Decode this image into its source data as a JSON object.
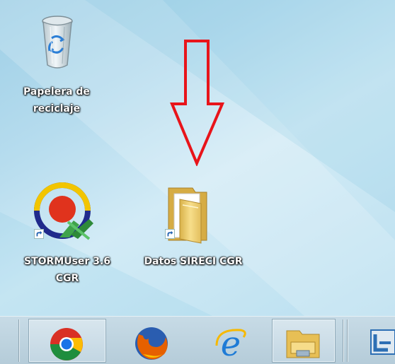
{
  "desktop": {
    "icons": [
      {
        "label_line1": "Papelera de",
        "label_line2": "reciclaje",
        "icon": "recycle-bin-icon",
        "shortcut": false
      },
      {
        "label_line1": "STORMUser 3.6",
        "label_line2": "CGR",
        "icon": "stormuser-app-icon",
        "shortcut": true
      },
      {
        "label_line1": "Datos SIRECI CGR",
        "label_line2": "",
        "icon": "folder-icon",
        "shortcut": true
      }
    ],
    "annotation": {
      "icon": "red-down-arrow-icon",
      "color": "#e8141a"
    }
  },
  "taskbar": {
    "pinned": [
      {
        "icon": "chrome-icon",
        "active": true
      },
      {
        "icon": "firefox-icon",
        "active": false
      },
      {
        "icon": "internet-explorer-icon",
        "active": false
      },
      {
        "icon": "file-explorer-icon",
        "active": true
      },
      {
        "icon": "app-shortcut-icon",
        "active": false
      }
    ]
  }
}
